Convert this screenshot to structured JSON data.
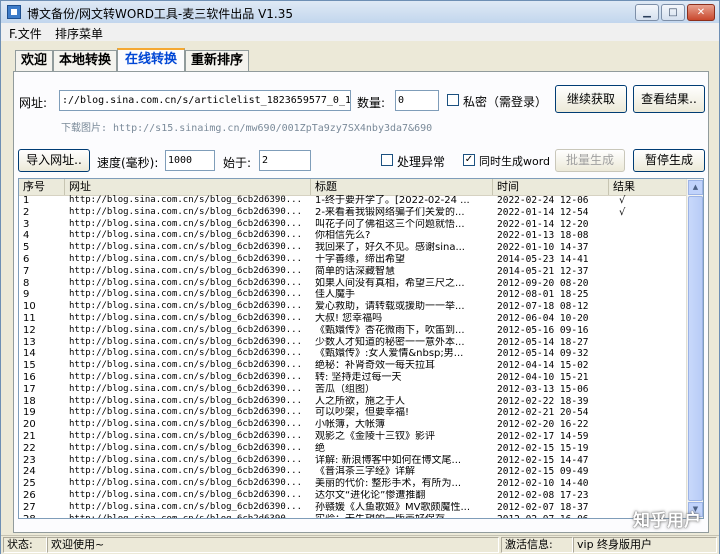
{
  "window": {
    "title": "博文备份/网文转WORD工具-麦三软件出品 V1.35",
    "min_label": "▁",
    "max_label": "□",
    "close_label": "✕"
  },
  "menu": [
    "F.文件",
    "排序菜单"
  ],
  "tabs": [
    "欢迎",
    "本地转换",
    "在线转换",
    "重新排序"
  ],
  "form": {
    "url_label": "网址:",
    "url_value": "://blog.sina.com.cn/s/articlelist_1823659577_0_1.html",
    "count_label": "数量:",
    "count_value": "0",
    "private_label": "私密（需登录）",
    "continue_button": "继续获取",
    "view_result_button": "查看结果..",
    "download_image_text": "下载图片: http://s15.sinaimg.cn/mw690/001ZpTa9zy7SX4nby3da7&690",
    "import_button": "导入网址..",
    "speed_label": "速度(毫秒):",
    "speed_value": "1000",
    "start_label": "始于:",
    "start_value": "2",
    "handle_error_label": "处理异常",
    "sync_word_label": "同时生成word",
    "batch_button": "批量生成",
    "pause_button": "暂停生成"
  },
  "table": {
    "headers": [
      "序号",
      "网址",
      "标题",
      "时间",
      "结果"
    ],
    "url_text": "http://blog.sina.com.cn/s/blog_6cb2d6390...",
    "rows": [
      {
        "n": "1",
        "title": "1-终于要开学了。[2022-02-24 ...",
        "time": "2022-02-24 12-06",
        "res": "√"
      },
      {
        "n": "2",
        "title": "2-来看着我锻网络骗子们关爱的...",
        "time": "2022-01-14 12-54",
        "res": "√"
      },
      {
        "n": "3",
        "title": "叫花子问了佛祖这三个问题就悟...",
        "time": "2022-01-14 12-20",
        "res": ""
      },
      {
        "n": "4",
        "title": "你相信先么?",
        "time": "2022-01-13 18-08",
        "res": ""
      },
      {
        "n": "5",
        "title": "我回来了，好久不见。感谢sina...",
        "time": "2022-01-10 14-37",
        "res": ""
      },
      {
        "n": "6",
        "title": "十字善缘，缔出希望",
        "time": "2014-05-23 14-41",
        "res": ""
      },
      {
        "n": "7",
        "title": "简单的话深藏智慧",
        "time": "2014-05-21 12-37",
        "res": ""
      },
      {
        "n": "8",
        "title": "如果人间没有真相，希望三尺之...",
        "time": "2012-09-20 08-20",
        "res": ""
      },
      {
        "n": "9",
        "title": "佳人魔手",
        "time": "2012-08-01 18-25",
        "res": ""
      },
      {
        "n": "10",
        "title": "爱心救助，请转载或援助一一举...",
        "time": "2012-07-18 08-12",
        "res": ""
      },
      {
        "n": "11",
        "title": "大叔! 您幸福吗",
        "time": "2012-06-04 10-20",
        "res": ""
      },
      {
        "n": "12",
        "title": "《甄嬛传》杏花微雨下，吹笛到...",
        "time": "2012-05-16 09-16",
        "res": ""
      },
      {
        "n": "13",
        "title": "少数人才知道的秘密一一意外本...",
        "time": "2012-05-14 18-27",
        "res": ""
      },
      {
        "n": "14",
        "title": "《甄嬛传》:女人爱情&nbsp;男...",
        "time": "2012-05-14 09-32",
        "res": ""
      },
      {
        "n": "15",
        "title": "绝秘：补肾奇效一每天拉耳",
        "time": "2012-04-14 15-02",
        "res": ""
      },
      {
        "n": "16",
        "title": "转: 坚持走过每一天",
        "time": "2012-04-10 15-21",
        "res": ""
      },
      {
        "n": "17",
        "title": "苦瓜（组图）",
        "time": "2012-03-13 15-06",
        "res": ""
      },
      {
        "n": "18",
        "title": "人之所欲，施之于人",
        "time": "2012-02-22 18-39",
        "res": ""
      },
      {
        "n": "19",
        "title": "可以吵架，但要幸福!",
        "time": "2012-02-21 20-54",
        "res": ""
      },
      {
        "n": "20",
        "title": "小帐簿，大帐簿",
        "time": "2012-02-20 16-22",
        "res": ""
      },
      {
        "n": "21",
        "title": "观影之《金陵十三钗》影评",
        "time": "2012-02-17 14-59",
        "res": ""
      },
      {
        "n": "22",
        "title": "绝",
        "time": "2012-02-15 15-19",
        "res": ""
      },
      {
        "n": "23",
        "title": "详解: 新浪博客中如何在博文尾...",
        "time": "2012-02-15 14-47",
        "res": ""
      },
      {
        "n": "24",
        "title": "《普洱茶三字经》详解",
        "time": "2012-02-15 09-49",
        "res": ""
      },
      {
        "n": "25",
        "title": "美丽的代价: 整形手术，有所为...",
        "time": "2012-02-10 14-40",
        "res": ""
      },
      {
        "n": "26",
        "title": "达尔文“进化论”惨遭推翻",
        "time": "2012-02-08 17-23",
        "res": ""
      },
      {
        "n": "27",
        "title": "孙赣媛《人鱼歌姬》MV歌颇魔性...",
        "time": "2012-02-07 18-37",
        "res": ""
      },
      {
        "n": "28",
        "title": "实验：无失望的一版画好保存",
        "time": "2012-02-07 16-06",
        "res": ""
      }
    ]
  },
  "status": {
    "state_label": "状态:",
    "state_value": "欢迎使用~",
    "activation_label": "激活信息:",
    "activation_value": "vip 终身版用户"
  },
  "watermark": "知乎用户"
}
